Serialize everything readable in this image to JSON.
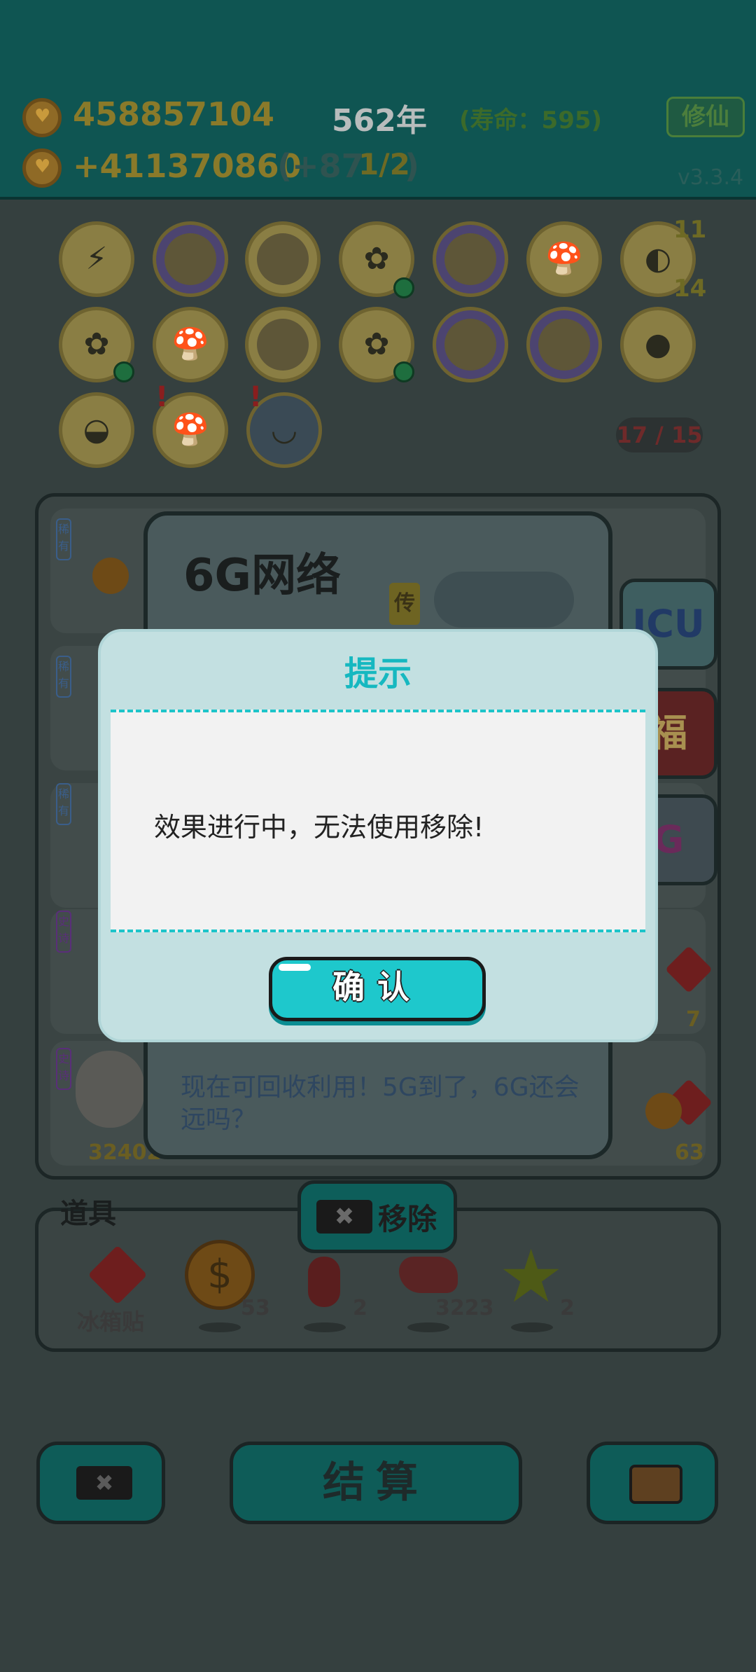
{
  "header": {
    "coins": "458857104",
    "income": "+411370860",
    "income_extra": "(+87",
    "progress": "1/2",
    "income_extra_close": ")",
    "year": "562年",
    "life": "(寿命：595)",
    "cultivate_label": "修仙",
    "version": "v3.3.4"
  },
  "badges": {
    "counts": [
      "11",
      "14"
    ],
    "capacity": "17 / 15"
  },
  "card": {
    "title": "6G网络",
    "description": "现在可回收利用！5G到了，6G还会远吗？",
    "legend_tag": "传",
    "side_label": "ICU",
    "side_fu": "福",
    "side_6g": "G"
  },
  "rows": {
    "tag": "稀有",
    "tag2": "史诗",
    "value_partial": "32402",
    "counts": [
      "7",
      "63"
    ],
    "fu": "福"
  },
  "tools": {
    "section_label": "道具",
    "remove_label": "移除",
    "items": [
      {
        "label": "冰箱贴",
        "icon": "fu-diamond-icon"
      },
      {
        "count": "53",
        "icon": "dollar-coin-icon"
      },
      {
        "count": "2",
        "icon": "chili-icon"
      },
      {
        "count": "3223",
        "icon": "liver-icon"
      },
      {
        "count": "2",
        "icon": "star-icon"
      }
    ]
  },
  "bottom": {
    "settle_label": "结算"
  },
  "dialog": {
    "title": "提示",
    "message": "效果进行中，无法使用移除!",
    "confirm_label": "确认"
  }
}
